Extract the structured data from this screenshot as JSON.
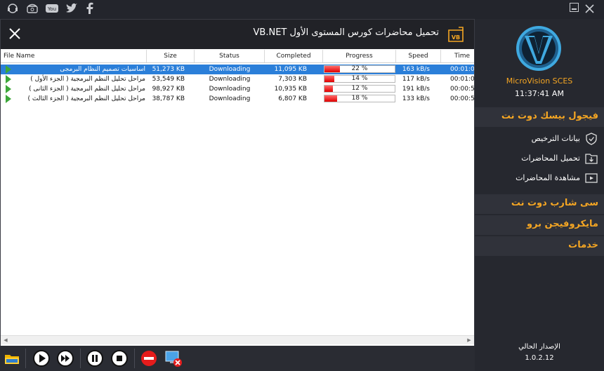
{
  "window": {
    "title": "تحميل محاضرات كورس المستوى الأول VB.NET",
    "top_icons": [
      "support-icon",
      "phone-icon",
      "youtube-icon",
      "twitter-icon",
      "facebook-icon"
    ]
  },
  "table": {
    "columns": [
      "File Name",
      "Size",
      "Status",
      "Completed",
      "Progress",
      "Speed",
      "Time"
    ],
    "rows": [
      {
        "name": "اساسيات تصميم النظام البرمجى",
        "size": "51,273 KB",
        "status": "Downloading",
        "completed": "11,095 KB",
        "progress_label": "22 %",
        "progress": 0.22,
        "speed": "163 kB/s",
        "time": "00:01:0",
        "selected": true
      },
      {
        "name": "مراحل تحليل النظم البرمجية ( الجزء الأول )",
        "size": "53,549 KB",
        "status": "Downloading",
        "completed": "7,303 KB",
        "progress_label": "14 %",
        "progress": 0.14,
        "speed": "117 kB/s",
        "time": "00:01:0",
        "selected": false
      },
      {
        "name": "مراحل تحليل النظم البرمجية ( الجزء الثانى )",
        "size": "98,927 KB",
        "status": "Downloading",
        "completed": "10,935 KB",
        "progress_label": "12 %",
        "progress": 0.12,
        "speed": "191 kB/s",
        "time": "00:00:5",
        "selected": false
      },
      {
        "name": "مراحل تحليل النظم البرمجية ( الجزء الثالث )",
        "size": "38,787 KB",
        "status": "Downloading",
        "completed": "6,807 KB",
        "progress_label": "18 %",
        "progress": 0.18,
        "speed": "133 kB/s",
        "time": "00:00:5",
        "selected": false
      }
    ]
  },
  "toolbar": {
    "buttons": [
      "folder-icon",
      "play-icon",
      "play-all-icon",
      "pause-icon",
      "stop-icon",
      "cancel-icon",
      "disconnect-icon"
    ]
  },
  "sidebar": {
    "brand": "MicroVision SCES",
    "clock": "11:37:41 AM",
    "sections": [
      {
        "label": "فيجول بيسك دوت نت",
        "items": [
          {
            "label": "بيانات الترخيص",
            "icon": "shield-check-icon"
          },
          {
            "label": "تحميل المحاضرات",
            "icon": "download-folder-icon"
          },
          {
            "label": "مشاهدة المحاضرات",
            "icon": "video-icon"
          }
        ]
      },
      {
        "label": "سى شارب دوت نت"
      },
      {
        "label": "مايكروفيجن برو"
      },
      {
        "label": "خدمات"
      }
    ],
    "version_label": "الإصدار الحالي",
    "version": "1.0.2.12"
  },
  "colors": {
    "accent": "#f5a623",
    "selection": "#2b7fd9",
    "progress": "#e00000",
    "play": "#3da73a"
  }
}
